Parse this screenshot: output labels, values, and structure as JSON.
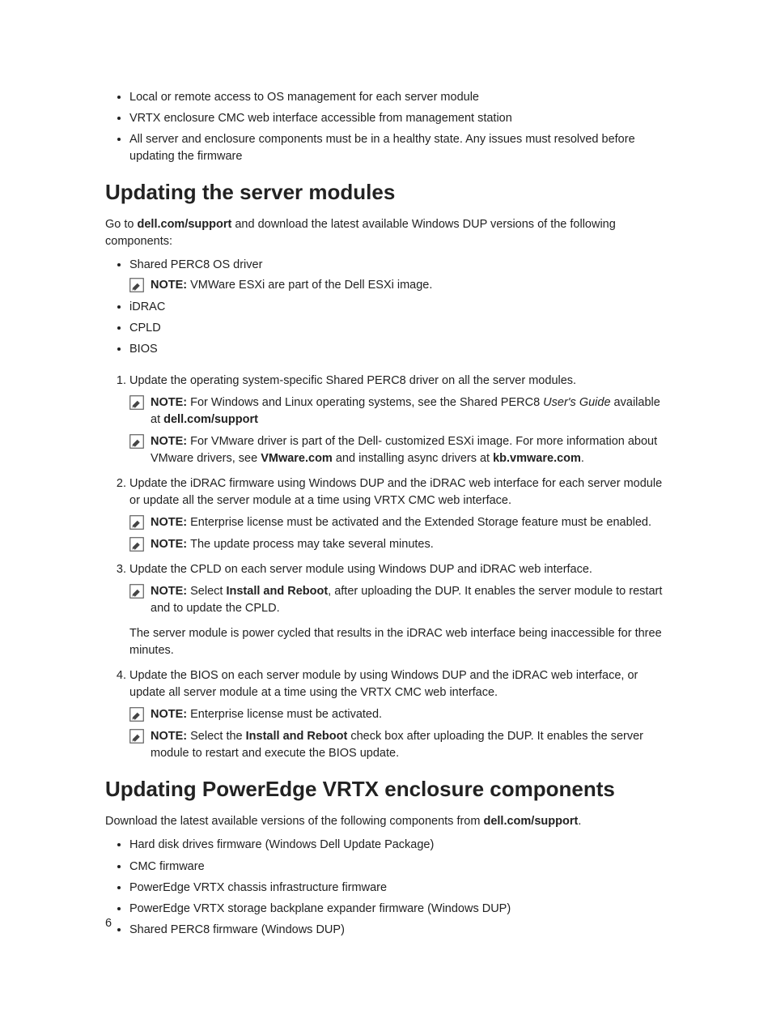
{
  "prereq_bullets": [
    "Local or remote access to OS management for each server module",
    "VRTX enclosure CMC web interface accessible from management station",
    "All server and enclosure components must be in a healthy state. Any issues must resolved before updating the firmware"
  ],
  "section1": {
    "heading": "Updating the server modules",
    "intro_pre": "Go to ",
    "intro_bold": "dell.com/support",
    "intro_post": " and download the latest available Windows DUP versions of the following components:",
    "comp_bullets": {
      "b1": "Shared PERC8 OS driver",
      "note1_label": "NOTE: ",
      "note1_text": "VMWare ESXi are part of the Dell ESXi image.",
      "b2": "iDRAC",
      "b3": "CPLD",
      "b4": "BIOS"
    },
    "steps": {
      "s1_text": "Update the operating system-specific Shared PERC8 driver on all the server modules.",
      "s1_note1_label": "NOTE: ",
      "s1_note1_a": "For Windows and Linux operating systems, see the Shared PERC8 ",
      "s1_note1_i": "User's Guide",
      "s1_note1_b": " available at ",
      "s1_note1_bold": "dell.com/support",
      "s1_note2_label": "NOTE: ",
      "s1_note2_a": "For VMware driver is part of the Dell- customized ESXi image. For more information about VMware drivers, see ",
      "s1_note2_bold1": "VMware.com",
      "s1_note2_b": " and installing async drivers at ",
      "s1_note2_bold2": "kb.vmware.com",
      "s1_note2_c": ".",
      "s2_text": "Update the iDRAC firmware using Windows DUP and the iDRAC web interface for each server module or update all the server module at a time using VRTX CMC web interface.",
      "s2_note1_label": "NOTE: ",
      "s2_note1_text": "Enterprise license must be activated and the Extended Storage feature must be enabled.",
      "s2_note2_label": "NOTE: ",
      "s2_note2_text": "The update process may take several minutes.",
      "s3_text": "Update the CPLD on each server module using Windows DUP and iDRAC web interface.",
      "s3_note1_label": "NOTE: ",
      "s3_note1_a": "Select ",
      "s3_note1_bold": "Install and Reboot",
      "s3_note1_b": ", after uploading the DUP. It enables the server module to restart and to update the CPLD.",
      "s3_post": "The server module is power cycled that results in the iDRAC web interface being inaccessible for three minutes.",
      "s4_text": "Update the BIOS on each server module by using Windows DUP and the iDRAC web interface, or update all server module at a time using the VRTX CMC web interface.",
      "s4_note1_label": "NOTE: ",
      "s4_note1_text": "Enterprise license must be activated.",
      "s4_note2_label": "NOTE: ",
      "s4_note2_a": "Select the ",
      "s4_note2_bold": "Install and Reboot",
      "s4_note2_b": " check box after uploading the DUP. It enables the server module to restart and execute the BIOS update."
    }
  },
  "section2": {
    "heading": "Updating PowerEdge VRTX enclosure components",
    "intro_a": "Download the latest available versions of the following components from ",
    "intro_bold": "dell.com/support",
    "intro_b": ".",
    "bullets": [
      "Hard disk drives firmware (Windows Dell Update Package)",
      "CMC firmware",
      "PowerEdge VRTX chassis infrastructure firmware",
      "PowerEdge VRTX storage backplane expander firmware (Windows DUP)",
      "Shared PERC8 firmware (Windows DUP)"
    ]
  },
  "page_number": "6"
}
